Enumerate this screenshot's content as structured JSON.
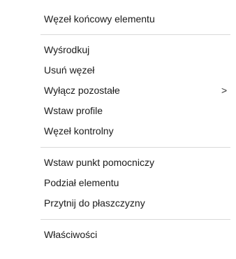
{
  "context_menu": {
    "groups": [
      {
        "items": [
          {
            "label": "Węzeł końcowy elementu"
          }
        ]
      },
      {
        "items": [
          {
            "label": "Wyśrodkuj"
          },
          {
            "label": "Usuń węzeł"
          },
          {
            "label": "Wyłącz pozostałe",
            "submenu_indicator": ">"
          },
          {
            "label": "Wstaw profile"
          },
          {
            "label": "Węzeł kontrolny"
          }
        ]
      },
      {
        "items": [
          {
            "label": "Wstaw punkt pomocniczy"
          },
          {
            "label": "Podział elementu"
          },
          {
            "label": "Przytnij do płaszczyzny"
          }
        ]
      },
      {
        "items": [
          {
            "label": "Właściwości"
          }
        ]
      }
    ]
  }
}
